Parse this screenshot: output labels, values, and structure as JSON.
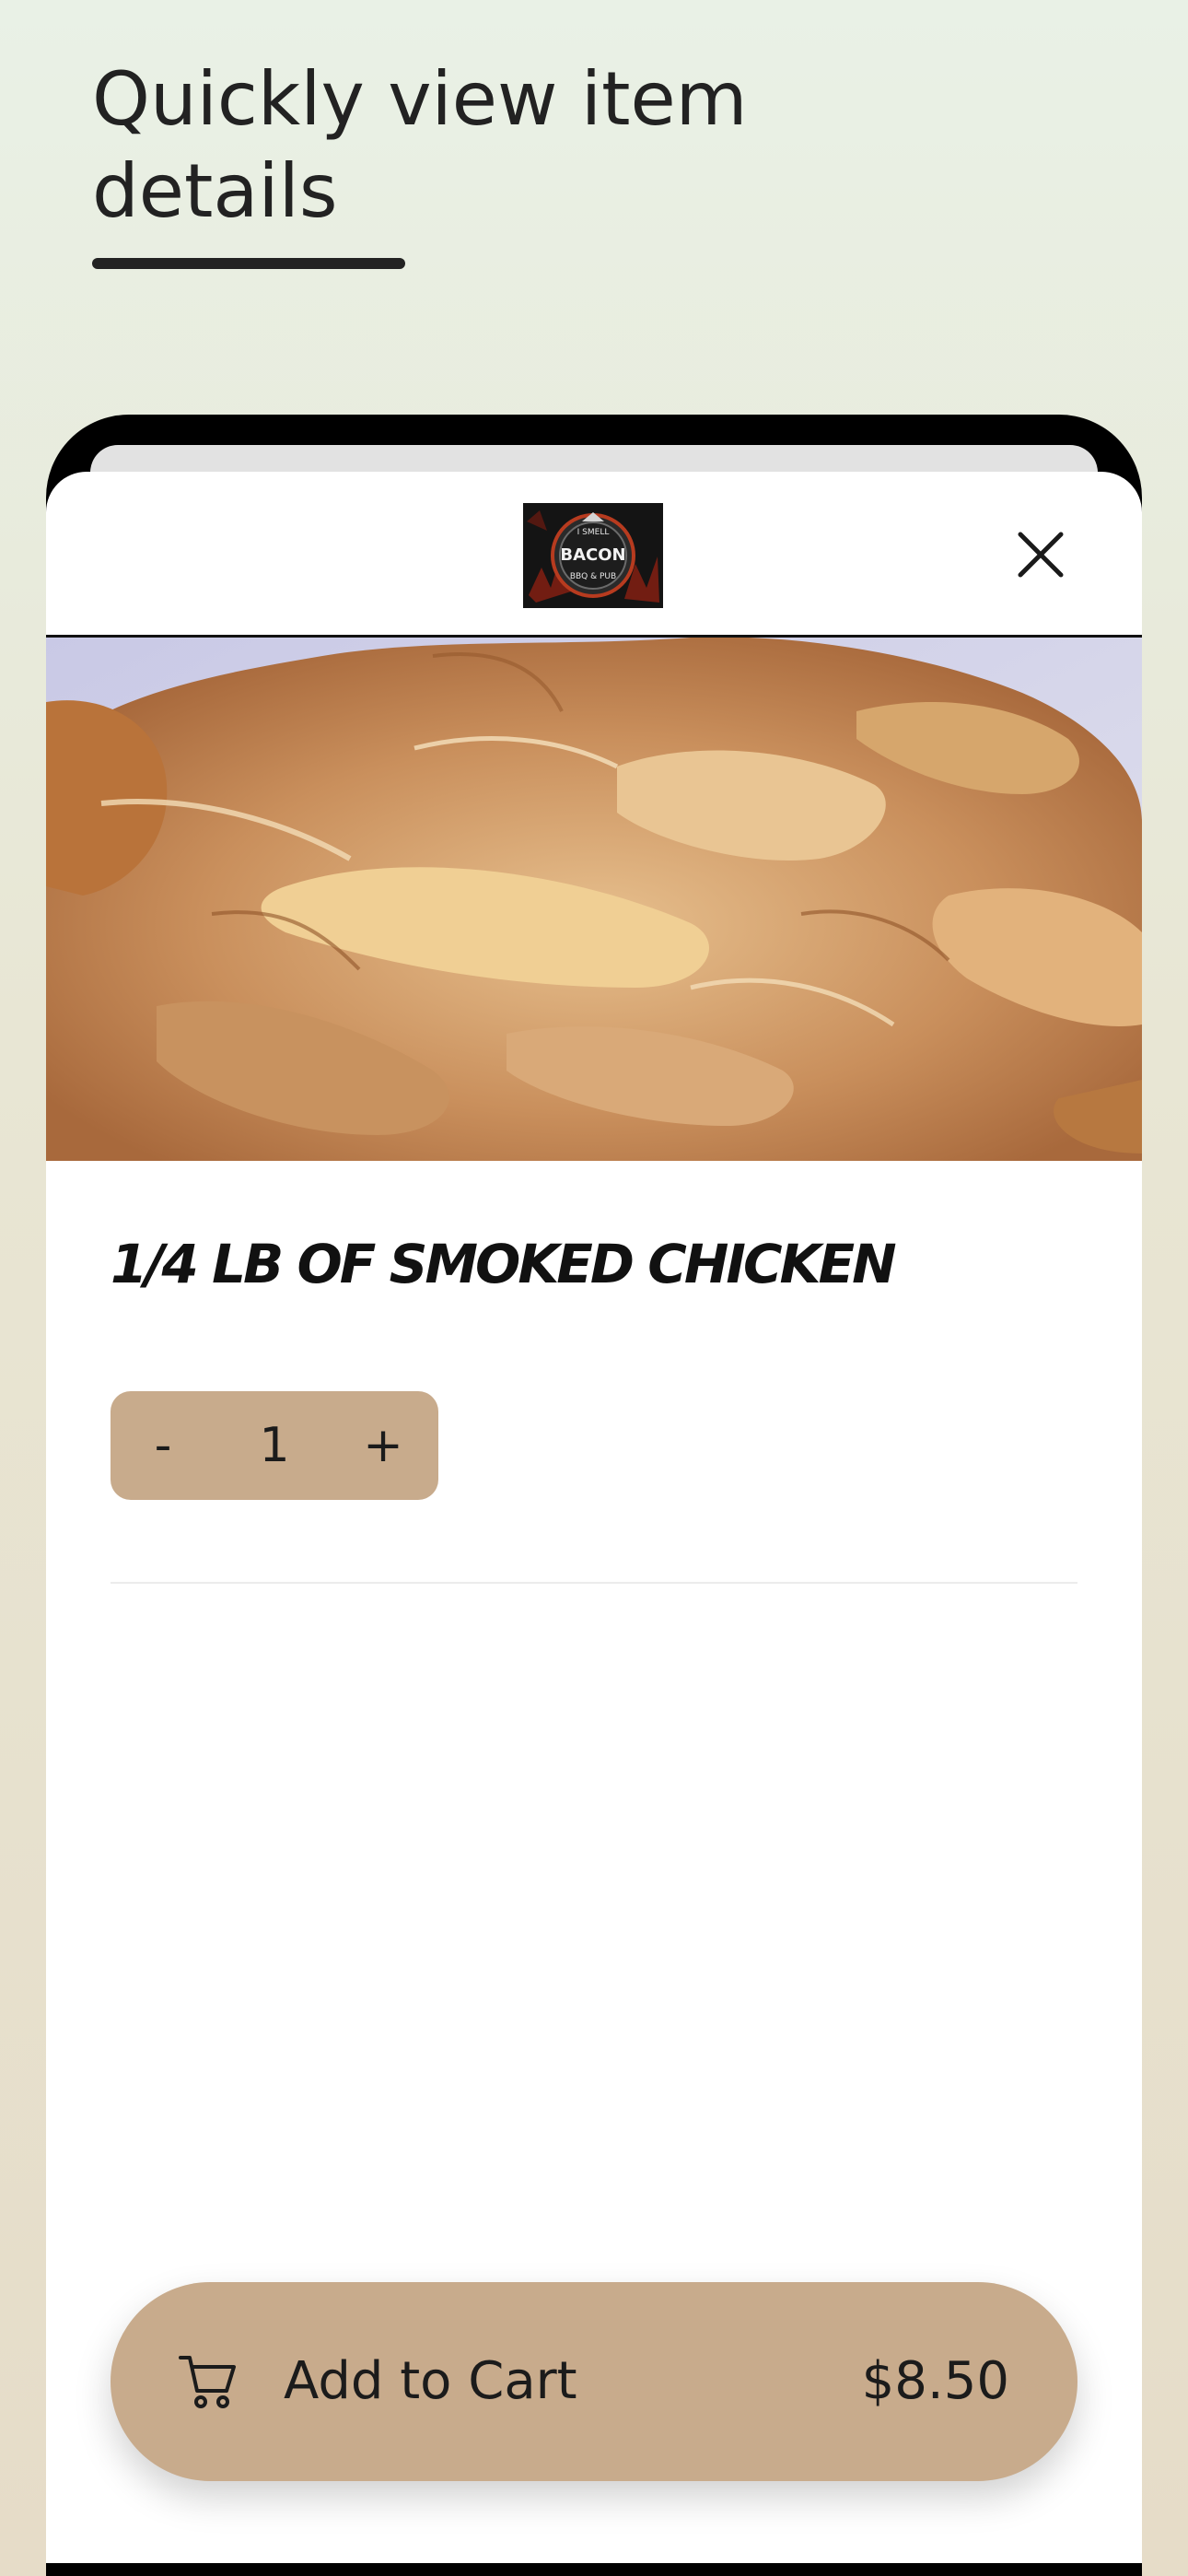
{
  "promo": {
    "headline": "Quickly view item details"
  },
  "modal": {
    "logo": {
      "text_top": "I SMELL",
      "text_main": "BACON",
      "text_bottom": "BBQ & PUB"
    },
    "close_icon": "close-x-icon",
    "item": {
      "title": "1/4 LB OF SMOKED CHICKEN",
      "quantity": "1",
      "decrement_label": "-",
      "increment_label": "+"
    },
    "cart": {
      "icon": "shopping-cart-icon",
      "label": "Add to Cart",
      "price": "$8.50"
    }
  },
  "colors": {
    "accent": "#c8ab8c",
    "background_top": "#e9f1e6",
    "background_bottom": "#e6dcc8",
    "text": "#1b1b1b"
  }
}
